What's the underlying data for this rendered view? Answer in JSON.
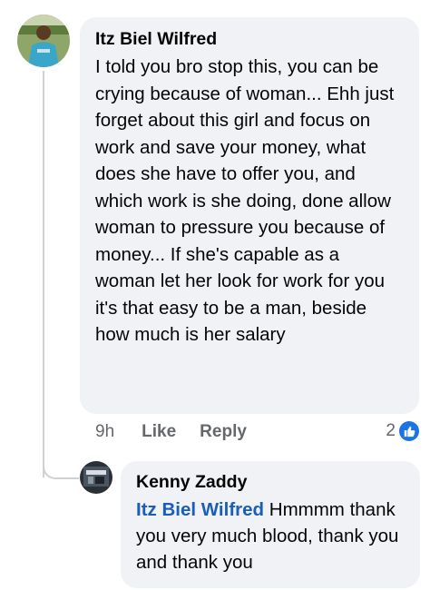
{
  "comment": {
    "author": "Itz Biel Wilfred",
    "text": "I told you bro stop this, you can be crying because of woman... Ehh just forget about this girl and focus on work and save your money, what does she have to offer you, and which work is she doing, done allow woman to pressure you because of money... If she's capable as a woman let her look for work for you it's that easy to be a man, beside how much is her salary",
    "time": "9h",
    "like_label": "Like",
    "reply_label": "Reply",
    "reaction_count": "2",
    "reaction_icon": "thumbs-up-icon",
    "colors": {
      "bubble": "#f0f2f5",
      "meta": "#65676b",
      "like_blue": "#1b74e4"
    }
  },
  "reply": {
    "author": "Kenny Zaddy",
    "mention": "Itz Biel Wilfred",
    "text": " Hmmmm thank you very much blood, thank you and thank you",
    "colors": {
      "mention": "#1b5eb8"
    }
  }
}
